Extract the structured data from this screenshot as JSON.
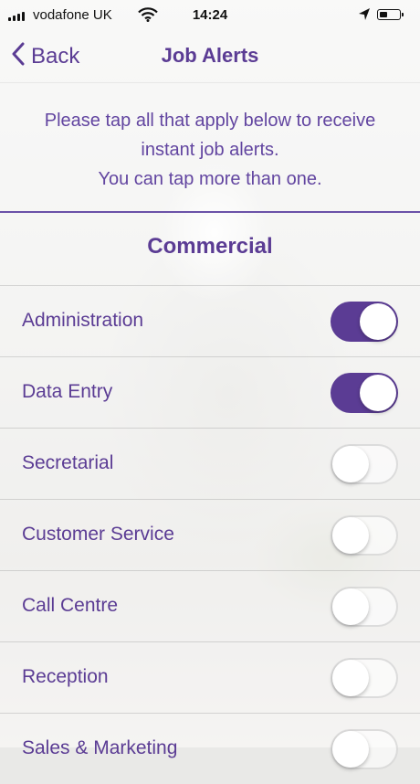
{
  "status_bar": {
    "carrier": "vodafone UK",
    "time": "14:24",
    "icons": [
      "signal-icon",
      "wifi-icon",
      "location-arrow-icon",
      "battery-icon"
    ]
  },
  "nav": {
    "back_label": "Back",
    "title": "Job Alerts"
  },
  "intro": {
    "line1": "Please tap all that apply below to receive",
    "line2": "instant job alerts.",
    "line3": "You can tap more than one."
  },
  "section": {
    "title": "Commercial"
  },
  "items": [
    {
      "label": "Administration",
      "on": true
    },
    {
      "label": "Data Entry",
      "on": true
    },
    {
      "label": "Secretarial",
      "on": false
    },
    {
      "label": "Customer Service",
      "on": false
    },
    {
      "label": "Call Centre",
      "on": false
    },
    {
      "label": "Reception",
      "on": false
    },
    {
      "label": "Sales & Marketing",
      "on": false
    }
  ],
  "colors": {
    "accent": "#5b3c94",
    "text": "#5b3c94"
  }
}
